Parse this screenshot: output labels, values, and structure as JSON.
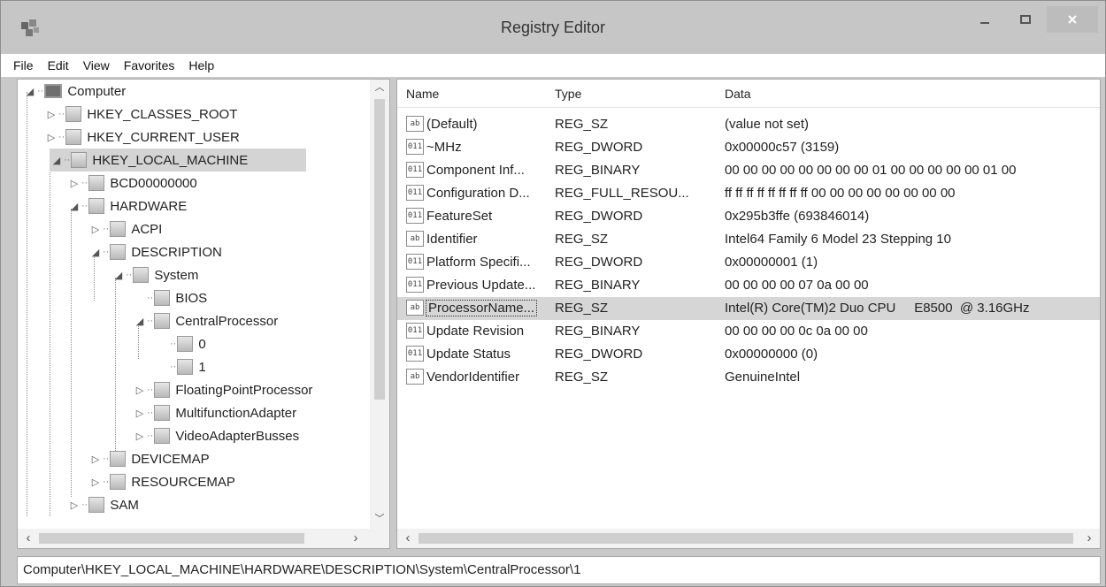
{
  "window": {
    "title": "Registry Editor"
  },
  "menu": [
    "File",
    "Edit",
    "View",
    "Favorites",
    "Help"
  ],
  "tree": [
    {
      "label": "Computer",
      "expander": "◢",
      "icon": "computer"
    },
    {
      "label": "HKEY_CLASSES_ROOT",
      "expander": "▷",
      "icon": "folder"
    },
    {
      "label": "HKEY_CURRENT_USER",
      "expander": "▷",
      "icon": "folder"
    },
    {
      "label": "HKEY_LOCAL_MACHINE",
      "expander": "◢",
      "icon": "folder",
      "selected": true
    },
    {
      "label": "BCD00000000",
      "expander": "▷",
      "icon": "folder"
    },
    {
      "label": "HARDWARE",
      "expander": "◢",
      "icon": "folder"
    },
    {
      "label": "ACPI",
      "expander": "▷",
      "icon": "folder"
    },
    {
      "label": "DESCRIPTION",
      "expander": "◢",
      "icon": "folder"
    },
    {
      "label": "System",
      "expander": "◢",
      "icon": "folder"
    },
    {
      "label": "BIOS",
      "expander": "",
      "icon": "folder"
    },
    {
      "label": "CentralProcessor",
      "expander": "◢",
      "icon": "folder"
    },
    {
      "label": "0",
      "expander": "",
      "icon": "folder"
    },
    {
      "label": "1",
      "expander": "",
      "icon": "folder"
    },
    {
      "label": "FloatingPointProcessor",
      "expander": "▷",
      "icon": "folder"
    },
    {
      "label": "MultifunctionAdapter",
      "expander": "▷",
      "icon": "folder"
    },
    {
      "label": "VideoAdapterBusses",
      "expander": "▷",
      "icon": "folder"
    },
    {
      "label": "DEVICEMAP",
      "expander": "▷",
      "icon": "folder"
    },
    {
      "label": "RESOURCEMAP",
      "expander": "▷",
      "icon": "folder"
    },
    {
      "label": "SAM",
      "expander": "▷",
      "icon": "folder"
    }
  ],
  "list": {
    "headers": {
      "name": "Name",
      "type": "Type",
      "data": "Data"
    },
    "rows": [
      {
        "icon": "ab",
        "name": "(Default)",
        "type": "REG_SZ",
        "data": "(value not set)"
      },
      {
        "icon": "bin",
        "name": "~MHz",
        "type": "REG_DWORD",
        "data": "0x00000c57 (3159)"
      },
      {
        "icon": "bin",
        "name": "Component Inf...",
        "type": "REG_BINARY",
        "data": "00 00 00 00 00 00 00 00 01 00 00 00 00 00 01 00"
      },
      {
        "icon": "bin",
        "name": "Configuration D...",
        "type": "REG_FULL_RESOU...",
        "data": "ff ff ff ff ff ff ff ff 00 00 00 00 00 00 00 00"
      },
      {
        "icon": "bin",
        "name": "FeatureSet",
        "type": "REG_DWORD",
        "data": "0x295b3ffe (693846014)"
      },
      {
        "icon": "ab",
        "name": "Identifier",
        "type": "REG_SZ",
        "data": "Intel64 Family 6 Model 23 Stepping 10"
      },
      {
        "icon": "bin",
        "name": "Platform Specifi...",
        "type": "REG_DWORD",
        "data": "0x00000001 (1)"
      },
      {
        "icon": "bin",
        "name": "Previous Update...",
        "type": "REG_BINARY",
        "data": "00 00 00 00 07 0a 00 00"
      },
      {
        "icon": "ab",
        "name": "ProcessorName...",
        "type": "REG_SZ",
        "data": "Intel(R) Core(TM)2 Duo CPU     E8500  @ 3.16GHz",
        "selected": true
      },
      {
        "icon": "bin",
        "name": "Update Revision",
        "type": "REG_BINARY",
        "data": "00 00 00 00 0c 0a 00 00"
      },
      {
        "icon": "bin",
        "name": "Update Status",
        "type": "REG_DWORD",
        "data": "0x00000000 (0)"
      },
      {
        "icon": "ab",
        "name": "VendorIdentifier",
        "type": "REG_SZ",
        "data": "GenuineIntel"
      }
    ]
  },
  "status": {
    "path": "Computer\\HKEY_LOCAL_MACHINE\\HARDWARE\\DESCRIPTION\\System\\CentralProcessor\\1"
  },
  "icon_glyphs": {
    "ab": "ab",
    "bin": "011"
  },
  "colors": {
    "titlebar": "#c6c6c6",
    "selection": "#d4d4d4",
    "close_button": "#bcbcbc"
  }
}
